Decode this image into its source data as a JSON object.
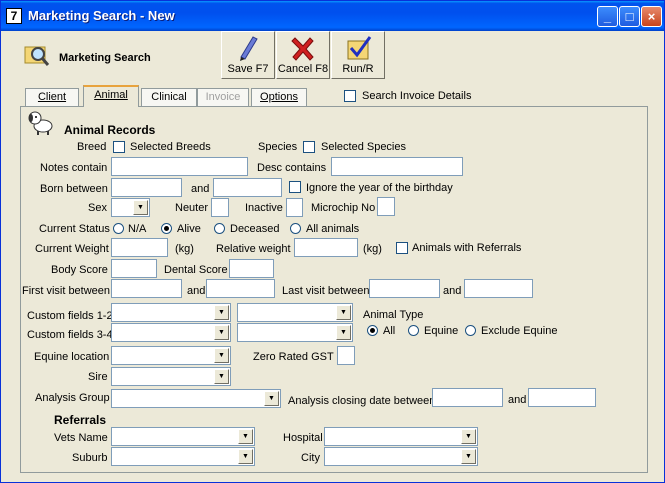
{
  "window": {
    "title": "Marketing Search - New",
    "app_icon_glyph": "7"
  },
  "toolbar": {
    "label": "Marketing Search",
    "save": "Save F7",
    "cancel": "Cancel F8",
    "run": "Run/R"
  },
  "tabs": [
    {
      "label": "Client",
      "state": "normal"
    },
    {
      "label": "Animal",
      "state": "active"
    },
    {
      "label": "Clinical",
      "state": "normal"
    },
    {
      "label": "Invoice",
      "state": "disabled"
    },
    {
      "label": "Options",
      "state": "normal"
    }
  ],
  "search_invoice_details": {
    "label": "Search Invoice Details",
    "checked": false
  },
  "animal": {
    "heading": "Animal Records",
    "breed": "Breed",
    "selected_breeds": "Selected Breeds",
    "species": "Species",
    "selected_species": "Selected Species",
    "notes_contain": "Notes contain",
    "desc_contains": "Desc contains",
    "born_between": "Born between",
    "and": "and",
    "ignore_year": "Ignore the year of the birthday",
    "sex": "Sex",
    "neuter": "Neuter",
    "inactive": "Inactive",
    "microchip": "Microchip No",
    "current_status": "Current Status",
    "status_options": [
      "N/A",
      "Alive",
      "Deceased",
      "All animals"
    ],
    "status_selected": "Alive",
    "current_weight": "Current Weight",
    "kg": "(kg)",
    "relative_weight": "Relative weight",
    "animals_with_referrals": "Animals with Referrals",
    "body_score": "Body Score",
    "dental_score": "Dental Score",
    "first_visit_between": "First visit between",
    "last_visit_between": "Last visit between",
    "custom_12": "Custom fields 1-2",
    "custom_34": "Custom fields 3-4",
    "animal_type": "Animal Type",
    "type_options": [
      "All",
      "Equine",
      "Exclude Equine"
    ],
    "type_selected": "All",
    "equine_location": "Equine location",
    "zero_rated_gst": "Zero Rated GST",
    "sire": "Sire",
    "analysis_group": "Analysis Group",
    "analysis_closing": "Analysis closing date between"
  },
  "referrals": {
    "heading": "Referrals",
    "vets_name": "Vets Name",
    "hospital": "Hospital",
    "suburb": "Suburb",
    "city": "City"
  }
}
